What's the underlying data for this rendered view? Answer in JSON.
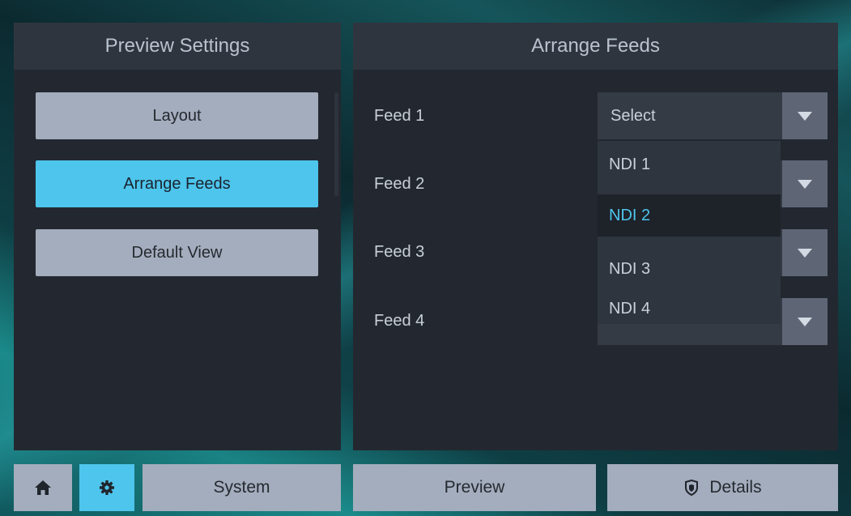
{
  "left_panel": {
    "title": "Preview Settings",
    "menu": [
      {
        "label": "Layout",
        "active": false
      },
      {
        "label": "Arrange Feeds",
        "active": true
      },
      {
        "label": "Default View",
        "active": false
      }
    ]
  },
  "right_panel": {
    "title": "Arrange Feeds",
    "feeds": [
      {
        "label": "Feed 1",
        "value": "Select"
      },
      {
        "label": "Feed 2",
        "value": ""
      },
      {
        "label": "Feed 3",
        "value": ""
      },
      {
        "label": "Feed 4",
        "value": ""
      }
    ],
    "dropdown_options": [
      {
        "label": "NDI 1",
        "selected": false
      },
      {
        "label": "NDI 2",
        "selected": true
      },
      {
        "label": "NDI 3",
        "selected": false
      },
      {
        "label": "NDI 4",
        "selected": false
      }
    ]
  },
  "bottom_bar": {
    "home_icon": "home-icon",
    "settings_icon": "gear-icon",
    "system_label": "System",
    "preview_label": "Preview",
    "details_label": "Details",
    "details_icon": "shield-icon"
  },
  "colors": {
    "accent": "#4ec5ec",
    "button": "#a4adbd",
    "panel": "#232830",
    "header": "#2f353e"
  }
}
